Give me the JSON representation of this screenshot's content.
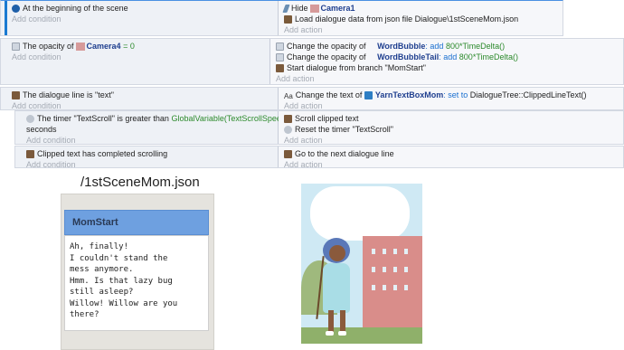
{
  "events": [
    {
      "condition_parts": [
        "At the beginning of the scene"
      ],
      "add_condition": "Add condition",
      "actions": [
        {
          "verb": "Hide",
          "object": "Camera1"
        },
        {
          "text": "Load dialogue data from json file Dialogue\\1stSceneMom.json"
        }
      ],
      "add_action": "Add action"
    },
    {
      "condition": {
        "prefix": "The opacity of",
        "object": "Camera4",
        "op": "= 0"
      },
      "add_condition": "Add condition",
      "actions": [
        {
          "prefix": "Change the opacity of",
          "object": "WordBubble",
          "mid": ": add",
          "value": "800*TimeDelta()"
        },
        {
          "prefix": "Change the opacity of",
          "object": "WordBubbleTail",
          "mid": ": add",
          "value": "800*TimeDelta()"
        },
        {
          "text": "Start dialogue from branch \"MomStart\""
        }
      ],
      "add_action": "Add action"
    },
    {
      "condition": {
        "text": "The dialogue line is \"text\""
      },
      "add_condition": "Add condition",
      "actions": [
        {
          "prefix": "Change the text of",
          "object": "YarnTextBoxMom",
          "mid": ": set to",
          "value": "DialogueTree::ClippedLineText()"
        }
      ],
      "add_action": "Add action"
    },
    {
      "condition": {
        "prefix": "The timer \"TextScroll\" is greater than",
        "value": "GlobalVariable(TextScrollSpeed)",
        "suffix": "seconds"
      },
      "add_condition": "Add condition",
      "actions": [
        {
          "text": "Scroll clipped text"
        },
        {
          "text": "Reset the timer \"TextScroll\""
        }
      ],
      "add_action": "Add action"
    },
    {
      "condition": {
        "text": "Clipped text has completed scrolling"
      },
      "add_condition": "Add condition",
      "actions": [
        {
          "text": "Go to the next dialogue line"
        }
      ],
      "add_action": "Add action"
    }
  ],
  "filename_caption": "/1stSceneMom.json",
  "dialogue_panel": {
    "title": "MomStart",
    "body": "Ah, finally!\nI couldn't stand the\nmess anymore.\nHmm. Is that lazy bug\nstill asleep?\nWillow! Willow are you\nthere?"
  },
  "colors": {
    "object_name": "#1f3f8f",
    "expression": "#2c8a2c",
    "add_placeholder": "#a4aab4",
    "panel_header": "#6ea0e0"
  }
}
